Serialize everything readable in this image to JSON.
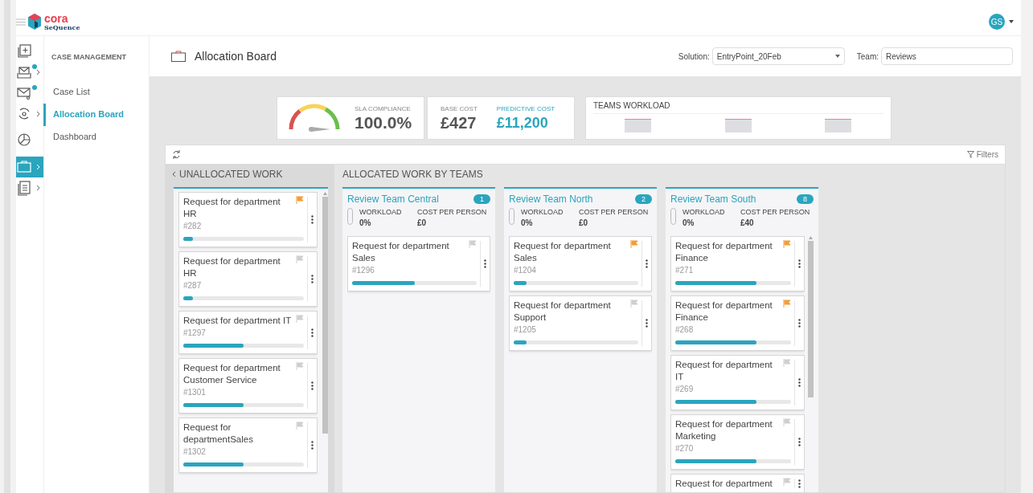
{
  "header": {
    "brand": "cora",
    "brand_sub": "SeQuence",
    "user_initials": "GS"
  },
  "rail": [
    {
      "kind": "new",
      "selected": false,
      "dot": false,
      "chevron": false
    },
    {
      "kind": "inbox",
      "selected": false,
      "dot": true,
      "chevron": true
    },
    {
      "kind": "mail",
      "selected": false,
      "dot": true,
      "chevron": false
    },
    {
      "kind": "cycle",
      "selected": false,
      "dot": false,
      "chevron": true
    },
    {
      "kind": "chart",
      "selected": false,
      "dot": false,
      "chevron": false
    },
    {
      "kind": "briefcase",
      "selected": true,
      "dot": false,
      "chevron": true
    },
    {
      "kind": "document",
      "selected": false,
      "dot": false,
      "chevron": true
    }
  ],
  "nav": {
    "heading": "CASE MANAGEMENT",
    "items": [
      {
        "label": "Case List",
        "selected": false
      },
      {
        "label": "Allocation Board",
        "selected": true
      },
      {
        "label": "Dashboard",
        "selected": false
      }
    ]
  },
  "page": {
    "title": "Allocation Board",
    "solution_label": "Solution:",
    "solution_value": "EntryPoint_20Feb",
    "team_label": "Team:",
    "team_value": "Reviews"
  },
  "kpis": {
    "sla_label": "SLA COMPLIANCE",
    "sla_value": "100.0%",
    "base_label": "BASE COST",
    "base_value": "£427",
    "predictive_label": "PREDICTIVE COST",
    "predictive_value": "£11,200",
    "workload_title": "TEAMS WORKLOAD"
  },
  "board": {
    "filters": "Filters",
    "unallocated_title": "UNALLOCATED WORK",
    "allocated_title": "ALLOCATED WORK BY TEAMS",
    "unallocated": [
      {
        "title": "Request for department HR",
        "id": "#282",
        "flagged": true,
        "level": 0.08
      },
      {
        "title": "Request for department HR",
        "id": "#287",
        "flagged": false,
        "level": 0.08
      },
      {
        "title": "Request for department IT",
        "id": "#1297",
        "flagged": false,
        "level": 0.5
      },
      {
        "title": "Request for department Customer Service",
        "id": "#1301",
        "flagged": false,
        "level": 0.5
      },
      {
        "title": "Request for departmentSales",
        "id": "#1302",
        "flagged": false,
        "level": 0.5
      }
    ],
    "teams": [
      {
        "name": "Review Team Central",
        "count": "1",
        "workload_label": "WORKLOAD",
        "workload": "0%",
        "cost_label": "COST PER PERSON",
        "cost": "£0",
        "scroll": false,
        "cards": [
          {
            "title": "Request for department Sales",
            "id": "#1296",
            "flagged": false,
            "level": 0.5
          }
        ]
      },
      {
        "name": "Review Team North",
        "count": "2",
        "workload_label": "WORKLOAD",
        "workload": "0%",
        "cost_label": "COST PER PERSON",
        "cost": "£0",
        "scroll": false,
        "cards": [
          {
            "title": "Request for department Sales",
            "id": "#1204",
            "flagged": true,
            "level": 0.1
          },
          {
            "title": "Request for department Support",
            "id": "#1205",
            "flagged": false,
            "level": 0.1
          }
        ]
      },
      {
        "name": "Review Team South",
        "count": "8",
        "workload_label": "WORKLOAD",
        "workload": "0%",
        "cost_label": "COST PER PERSON",
        "cost": "£40",
        "scroll": true,
        "cards": [
          {
            "title": "Request for department Finance",
            "id": "#271",
            "flagged": true,
            "level": 0.7
          },
          {
            "title": "Request for department Finance",
            "id": "#268",
            "flagged": true,
            "level": 0.7
          },
          {
            "title": "Request for department IT",
            "id": "#269",
            "flagged": false,
            "level": 0.7
          },
          {
            "title": "Request for department Marketing",
            "id": "#270",
            "flagged": false,
            "level": 0.7
          },
          {
            "title": "Request for department",
            "flagged": false
          }
        ]
      }
    ]
  }
}
